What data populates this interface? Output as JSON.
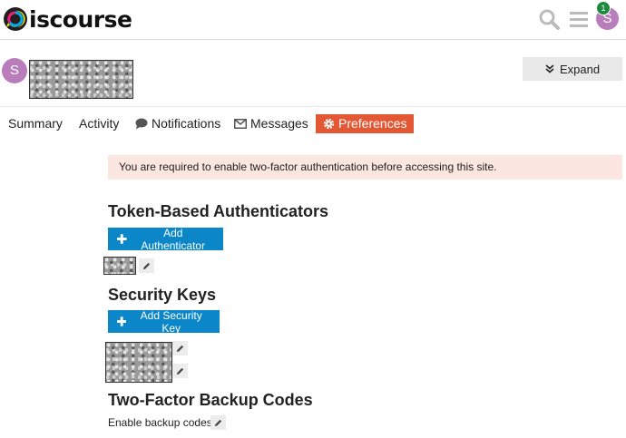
{
  "header": {
    "logo_text": "iscourse",
    "notification_count": "1",
    "avatar_letter": "S"
  },
  "user": {
    "avatar_letter": "S",
    "expand_label": "Expand"
  },
  "nav": {
    "summary": "Summary",
    "activity": "Activity",
    "notifications": "Notifications",
    "messages": "Messages",
    "preferences": "Preferences"
  },
  "alert": "You are required to enable two-factor authentication before accessing this site.",
  "sections": {
    "token_title": "Token-Based Authenticators",
    "add_authenticator": "Add Authenticator",
    "security_title": "Security Keys",
    "add_security_key": "Add Security Key",
    "backup_title": "Two-Factor Backup Codes",
    "backup_label": "Enable backup codes"
  },
  "colors": {
    "accent": "#e45735",
    "primary": "#0a86c9",
    "avatar": "#b97dbb",
    "alert_bg": "#fbe6e1",
    "badge": "#1e8a3c"
  }
}
